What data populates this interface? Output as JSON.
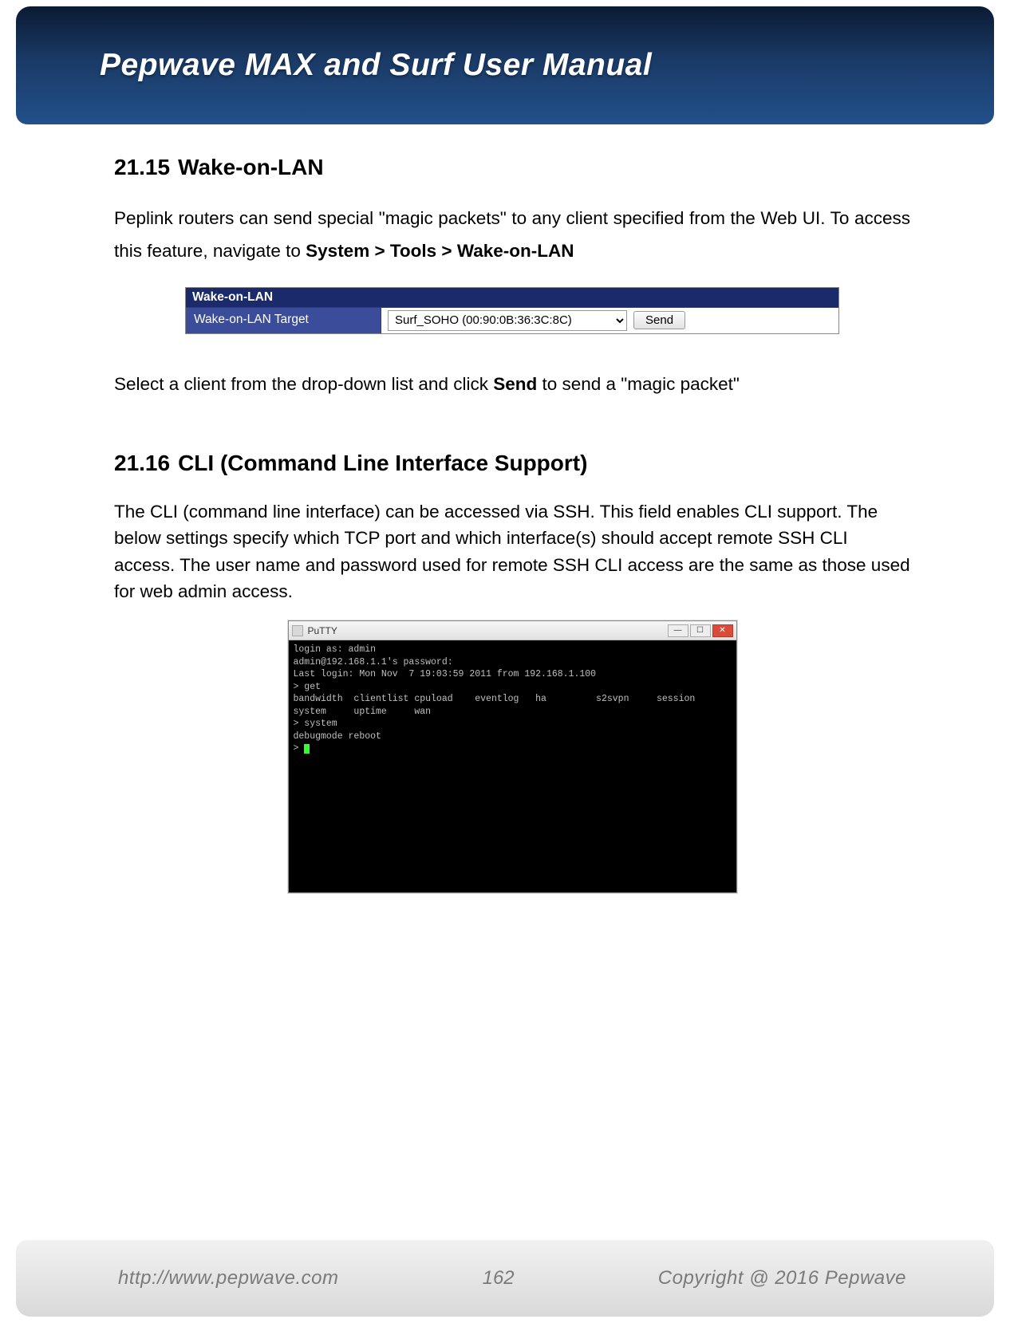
{
  "header": {
    "title": "Pepwave MAX and Surf User Manual"
  },
  "sections": {
    "s1": {
      "num": "21.15",
      "title": "Wake-on-LAN",
      "para1_a": "Peplink routers can send special \"magic packets\" to any client specified from the Web UI. To access this feature, navigate to ",
      "para1_path1": "System > Tools > Wake-on-LAN",
      "after_widget_a": "Select a client from the drop-down list and click ",
      "after_widget_b": "Send",
      "after_widget_c": " to send a \"magic packet\""
    },
    "s2": {
      "num": "21.16",
      "title": "CLI (Command Line Interface Support)",
      "para": "The CLI (command line interface) can be accessed via SSH. This field enables CLI support. The below settings specify which TCP port and which interface(s) should accept remote SSH CLI access. The user name and password used for remote SSH CLI access are the same as those used for web admin access."
    }
  },
  "wol_widget": {
    "panel_title": "Wake-on-LAN",
    "row_label": "Wake-on-LAN Target",
    "selected": "Surf_SOHO (00:90:0B:36:3C:8C)",
    "button": "Send"
  },
  "putty": {
    "title": "PuTTY",
    "lines": "login as: admin\nadmin@192.168.1.1's password:\nLast login: Mon Nov  7 19:03:59 2011 from 192.168.1.100\n> get\nbandwidth  clientlist cpuload    eventlog   ha         s2svpn     session\nsystem     uptime     wan\n> system\ndebugmode reboot\n> "
  },
  "footer": {
    "url": "http://www.pepwave.com",
    "page": "162",
    "copyright": "Copyright @ 2016 Pepwave"
  }
}
